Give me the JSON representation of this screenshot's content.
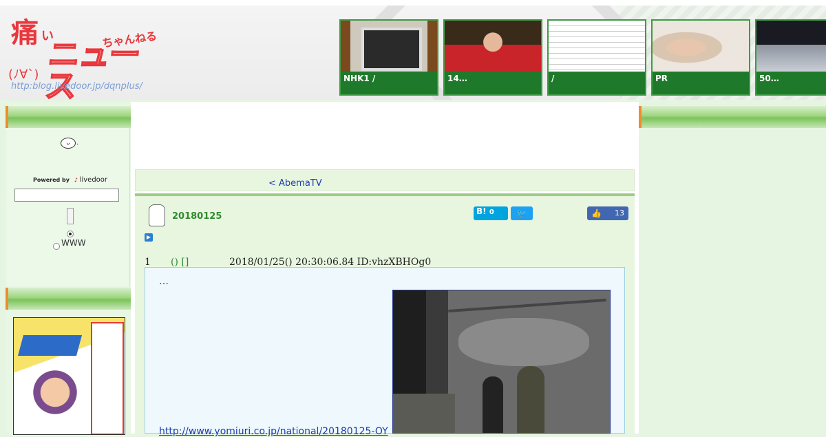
{
  "header": {
    "logo": {
      "kanji": "痛",
      "kana_i": "い",
      "chan": "ちゃんねる",
      "news": "ニュース",
      "face": "(ﾉ∀`)",
      "url": "http:blog.livedoor.jp/dqnplus/"
    },
    "thumbnails": [
      {
        "caption": "NHK1 /",
        "icon": "tv-photo"
      },
      {
        "caption": "14…",
        "icon": "table-tennis-photo"
      },
      {
        "caption": "/",
        "icon": "tweet-screenshot"
      },
      {
        "caption": "PR",
        "icon": "woman-portrait-photo"
      },
      {
        "caption": "50…",
        "icon": "snow-street-photo"
      }
    ]
  },
  "sidebar": {
    "face_icon": "face-icon",
    "dot": ".",
    "powered_by": "Powered by",
    "livedoor": "livedoor",
    "search_value": "",
    "www_label": "WWW"
  },
  "nav": {
    "link": "< AbemaTV　　　　"
  },
  "article": {
    "date": "20180125",
    "hatena_label": "B!",
    "hatena_count": "0",
    "like_count": "13",
    "post_number": "1",
    "post_name": "() []",
    "post_meta": "2018/01/25() 20:30:06.84 ID:vhzXBHOg0",
    "quote_text": "…",
    "quote_link": "http://www.yomiuri.co.jp/national/20180125-OY"
  },
  "colors": {
    "accent_green": "#1e7a2a",
    "bar_orange": "#f08c2e",
    "link_blue": "#1a3db0"
  }
}
